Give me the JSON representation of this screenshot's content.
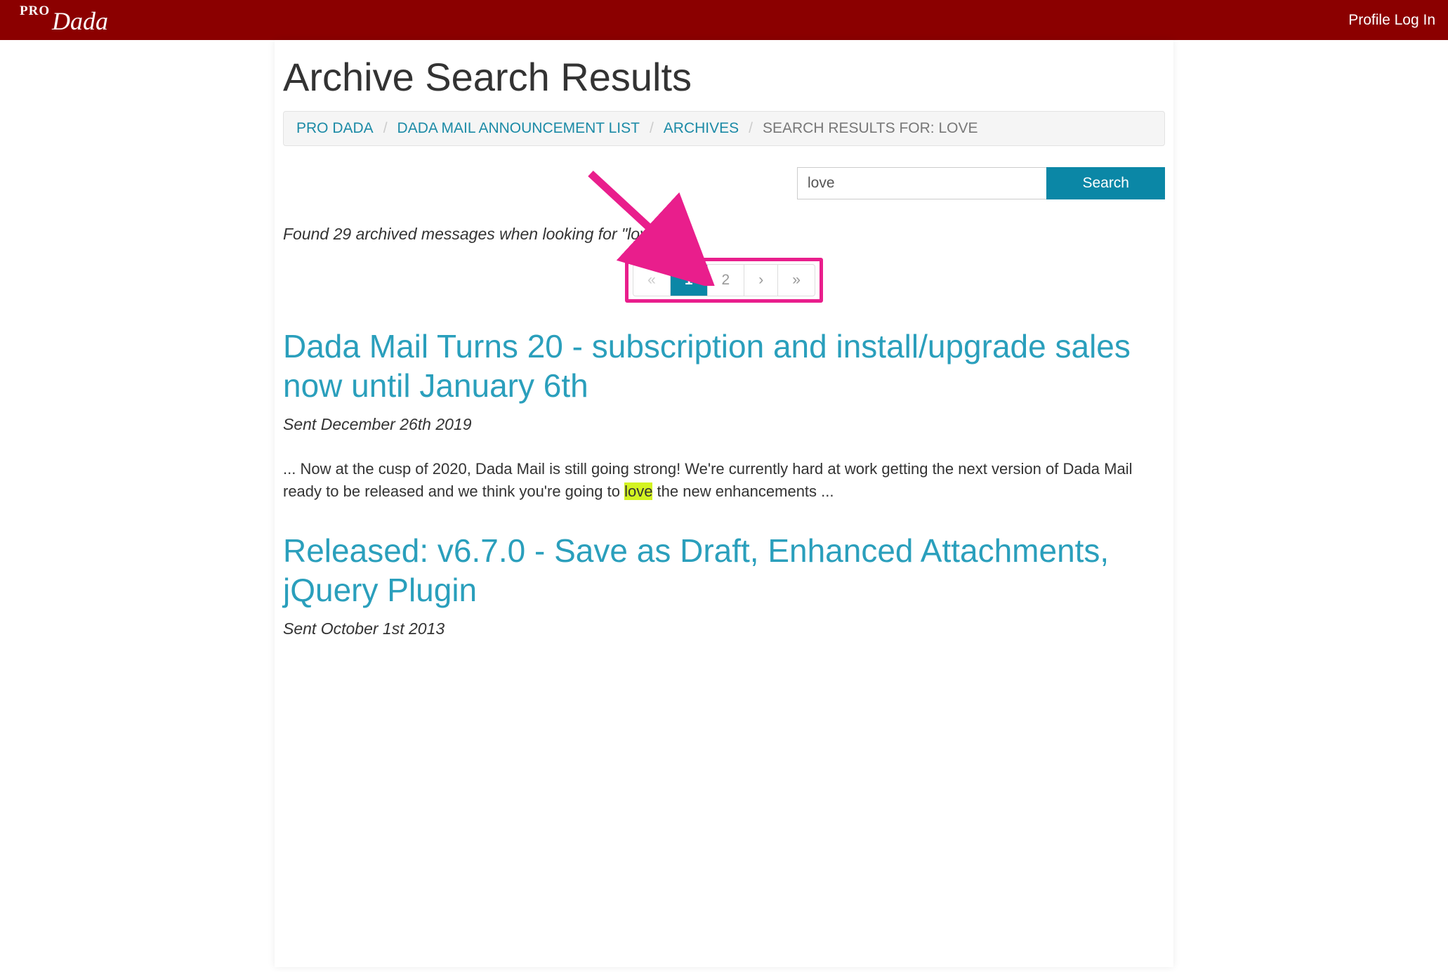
{
  "header": {
    "logo_pro": "PRO",
    "logo_dada": "Dada",
    "profile_link": "Profile Log In"
  },
  "page_title": "Archive Search Results",
  "breadcrumb": {
    "items": [
      {
        "label": "PRO DADA",
        "link": true
      },
      {
        "label": "DADA MAIL ANNOUNCEMENT LIST",
        "link": true
      },
      {
        "label": "ARCHIVES",
        "link": true
      },
      {
        "label": "SEARCH RESULTS FOR: LOVE",
        "link": false
      }
    ],
    "sep": "/"
  },
  "search": {
    "value": "love",
    "button": "Search"
  },
  "found_prefix": "Found 29 archived messages when looking for \"",
  "found_term": "love",
  "found_suffix": "\":",
  "pagination": {
    "first": "«",
    "prev_label": "",
    "pages": [
      "1",
      "2"
    ],
    "next": "›",
    "last": "»",
    "active": 0
  },
  "results": [
    {
      "title": "Dada Mail Turns 20 - subscription and install/upgrade sales now until January 6th",
      "sent": "Sent December 26th 2019",
      "excerpt_before": "... Now at the cusp of 2020, Dada Mail is still going strong! We're currently hard at work getting the next version of Dada Mail ready to be released and we think you're going to ",
      "highlight": "love",
      "excerpt_after": " the new enhancements ..."
    },
    {
      "title": "Released: v6.7.0 - Save as Draft, Enhanced Attachments, jQuery Plugin",
      "sent": "Sent October 1st 2013",
      "excerpt_before": "",
      "highlight": "",
      "excerpt_after": ""
    }
  ]
}
